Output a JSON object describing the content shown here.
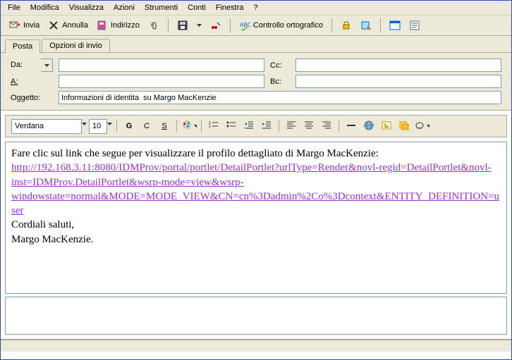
{
  "menu": [
    "File",
    "Modifica",
    "Visualizza",
    "Azioni",
    "Strumenti",
    "Conti",
    "Finestra",
    "?"
  ],
  "toolbar": {
    "send": "Invia",
    "cancel": "Annulla",
    "address": "Indirizzo",
    "spellcheck": "Controllo ortografico"
  },
  "tabs": {
    "mail": "Posta",
    "sendopts": "Opzioni di invio"
  },
  "fields": {
    "from": "Da:",
    "cc": "Cc:",
    "to": "A:",
    "bc": "Bc:",
    "subject": "Oggetto:",
    "from_value": "",
    "cc_value": "",
    "to_value": "",
    "bc_value": "",
    "subject_value": "Informazioni di identita  su Margo MacKenzie"
  },
  "format": {
    "font": "Verdana",
    "size": "10"
  },
  "body": {
    "intro": "Fare clic sul link che segue per visualizzare il profilo dettagliato di Margo MacKenzie:",
    "link": "http://192.168.3.11:8080/IDMProv/portal/portlet/DetailPortlet?urlType=Render&novl-regid=DetailPortlet&novl-inst=IDMProv.DetailPortlet&wsrp-mode=view&wsrp-windowstate=normal&MODE=MODE_VIEW&CN=cn%3Dadmin%2Co%3Dcontext&ENTITY_DEFINITION=user",
    "signoff1": "Cordiali saluti,",
    "signoff2": "Margo MacKenzie."
  }
}
